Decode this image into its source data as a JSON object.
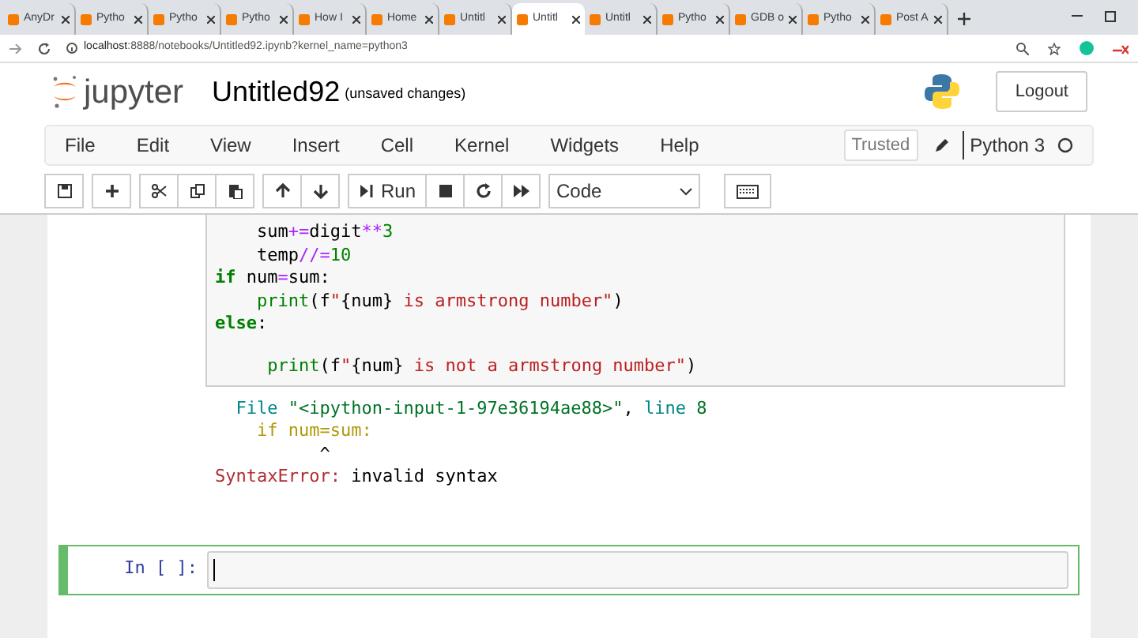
{
  "browser_tabs": [
    {
      "label": "AnyDr",
      "selected": false
    },
    {
      "label": "Pytho",
      "selected": false
    },
    {
      "label": "Pytho",
      "selected": false
    },
    {
      "label": "Pytho",
      "selected": false
    },
    {
      "label": "How I",
      "selected": false
    },
    {
      "label": "Home",
      "selected": false
    },
    {
      "label": "Untitl",
      "selected": false
    },
    {
      "label": "Untitl",
      "selected": true
    },
    {
      "label": "Untitl",
      "selected": false
    },
    {
      "label": "Pytho",
      "selected": false
    },
    {
      "label": "GDB o",
      "selected": false
    },
    {
      "label": "Pytho",
      "selected": false
    },
    {
      "label": "Post A",
      "selected": false
    }
  ],
  "address_bar": {
    "host": "localhost",
    "rest": ":8888/notebooks/Untitled92.ipynb?kernel_name=python3"
  },
  "header": {
    "logo_text": "jupyter",
    "notebook_title": "Untitled92",
    "save_status": "(unsaved changes)",
    "logout": "Logout"
  },
  "menu": [
    "File",
    "Edit",
    "View",
    "Insert",
    "Cell",
    "Kernel",
    "Widgets",
    "Help"
  ],
  "kernel": {
    "trusted": "Trusted",
    "name": "Python 3"
  },
  "toolbar": {
    "run": "Run",
    "cell_type": "Code"
  },
  "code_cell": {
    "lines": [
      {
        "blank_line_before": false,
        "tokens": [
          {
            "text": "    sum",
            "kind": "plain"
          },
          {
            "text": "+=",
            "kind": "op"
          },
          {
            "text": "digit",
            "kind": "plain"
          },
          {
            "text": "**",
            "kind": "op"
          },
          {
            "text": "3",
            "kind": "num"
          }
        ]
      },
      {
        "blank_line_before": false,
        "tokens": [
          {
            "text": "    temp",
            "kind": "plain"
          },
          {
            "text": "//=",
            "kind": "op"
          },
          {
            "text": "10",
            "kind": "num"
          }
        ]
      },
      {
        "blank_line_before": false,
        "tokens": [
          {
            "text": "if",
            "kind": "kw"
          },
          {
            "text": " num",
            "kind": "plain"
          },
          {
            "text": "=",
            "kind": "op"
          },
          {
            "text": "sum:",
            "kind": "plain"
          }
        ]
      },
      {
        "blank_line_before": false,
        "tokens": [
          {
            "text": "    print",
            "kind": "builtin"
          },
          {
            "text": "(f",
            "kind": "plain"
          },
          {
            "text": "\"",
            "kind": "str"
          },
          {
            "text": "{num}",
            "kind": "plain"
          },
          {
            "text": " is armstrong number\"",
            "kind": "str"
          },
          {
            "text": ")",
            "kind": "plain"
          }
        ]
      },
      {
        "blank_line_before": false,
        "tokens": [
          {
            "text": "else",
            "kind": "kw"
          },
          {
            "text": ":",
            "kind": "plain"
          }
        ]
      },
      {
        "blank_line_before": true,
        "tokens": [
          {
            "text": "     print",
            "kind": "builtin"
          },
          {
            "text": "(f",
            "kind": "plain"
          },
          {
            "text": "\"",
            "kind": "str"
          },
          {
            "text": "{num}",
            "kind": "plain"
          },
          {
            "text": " is not a armstrong number\"",
            "kind": "str"
          },
          {
            "text": ")",
            "kind": "plain"
          }
        ]
      }
    ]
  },
  "output": {
    "lines": [
      [
        {
          "text": "  File ",
          "kind": "teal"
        },
        {
          "text": "\"<ipython-input-1-97e36194ae88>\"",
          "kind": "green"
        },
        {
          "text": ", ",
          "kind": "plain"
        },
        {
          "text": "line ",
          "kind": "teal"
        },
        {
          "text": "8",
          "kind": "green"
        }
      ],
      [
        {
          "text": "    if num=sum:",
          "kind": "yellow"
        }
      ],
      [
        {
          "text": "          ^",
          "kind": "plain"
        }
      ],
      [
        {
          "text": "SyntaxError",
          "kind": "red"
        },
        {
          "text": ":",
          "kind": "red"
        },
        {
          "text": " invalid syntax",
          "kind": "plain"
        }
      ]
    ]
  },
  "next_cell": {
    "prompt": "In [ ]:"
  }
}
